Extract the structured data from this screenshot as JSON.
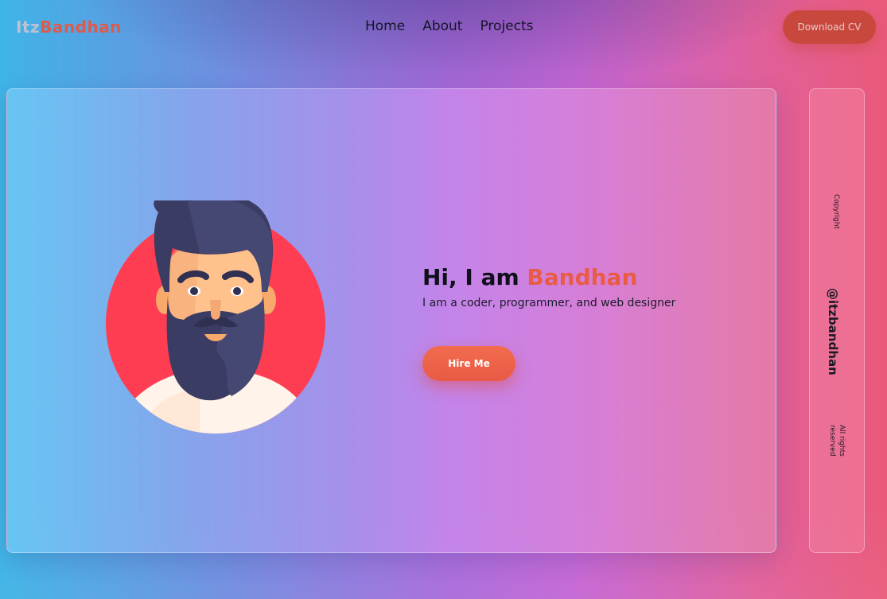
{
  "brand": {
    "part1": "Itz",
    "part2": "Bandhan"
  },
  "nav": {
    "links": [
      "Home",
      "About",
      "Projects"
    ],
    "download_cv": "Download CV"
  },
  "hero": {
    "greeting": "Hi, I am ",
    "name": "Bandhan",
    "subtitle": "I am a coder, programmer, and web designer",
    "hire_button": "Hire Me",
    "avatar_icon": "bearded-man-avatar"
  },
  "side": {
    "copyright": "Copyright",
    "handle": "@itzbandhan",
    "rights": "All rights reserved"
  },
  "colors": {
    "accent": "#ea5b45",
    "cv_button": "#c8483e",
    "avatar_circle": "#ff3d52"
  }
}
